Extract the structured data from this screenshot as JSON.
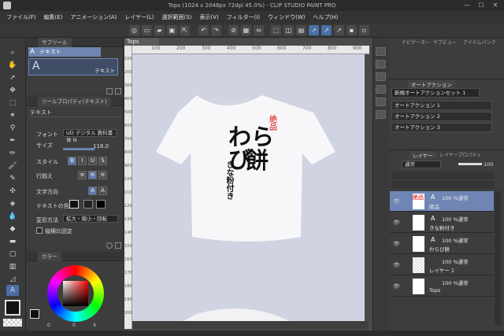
{
  "window": {
    "title": "Tops (1024 x 2048px 72dpi 45.0%) - CLIP STUDIO PAINT PRO",
    "min": "—",
    "max": "☐",
    "close": "✕"
  },
  "menu": [
    "ファイル(F)",
    "編集(E)",
    "アニメーション(A)",
    "レイヤー(L)",
    "選択範囲(S)",
    "表示(V)",
    "フィルター(I)",
    "ウィンドウ(W)",
    "ヘルプ(H)"
  ],
  "subtool": {
    "tab": "サブツール",
    "selected": "テキスト",
    "big_label": "テキスト",
    "big_icon": "A"
  },
  "toolprop": {
    "tab": "ツールプロパティ(テキスト)",
    "heading": "テキスト",
    "font_label": "フォント",
    "font_value": "UD デジタル 教科書体 N",
    "size_label": "サイズ",
    "size_value": "118.0",
    "style_label": "スタイル",
    "bold": "B",
    "italic": "I",
    "underline": "U",
    "strike": "S",
    "align_label": "行揃え",
    "direction_label": "文字方向",
    "color_label": "テキストの色",
    "transform_label": "変形方法",
    "transform_value": "拡大・縮小・回転",
    "keep_ratio_label": "縦横比固定"
  },
  "colorpanel": {
    "tab": "カラー",
    "values": [
      "0",
      "0",
      "4"
    ]
  },
  "canvas": {
    "tab": "Tops",
    "ruler_top": [
      "100",
      "200",
      "300",
      "400",
      "500",
      "600",
      "700",
      "800",
      "900"
    ],
    "ruler_left": [
      "100",
      "200",
      "300",
      "400",
      "500",
      "600",
      "700",
      "800",
      "900",
      "1000",
      "1100",
      "1200",
      "1300",
      "1400",
      "1500",
      "1600",
      "1700",
      "1800",
      "1900",
      "2000"
    ],
    "text_red": "絶品",
    "text_main_1": "わらび",
    "text_main_2": "餅",
    "text_sub": "きな粉付き"
  },
  "nav": {
    "tab1": "ナビゲーター",
    "tab2": "サブビュー",
    "tab3": "アイテムバンク"
  },
  "actions": {
    "tab": "オートアクション",
    "set": "新規オートアクションセット 1",
    "items": [
      "オートアクション 1",
      "オートアクション 2",
      "オートアクション 3"
    ]
  },
  "layers": {
    "tab": "レイヤー",
    "tab2": "レイヤープロパティ",
    "blend": "通常",
    "opacity": "100",
    "items": [
      {
        "mode": "100 %通常",
        "name": "絶品"
      },
      {
        "mode": "100 %通常",
        "name": "きな粉付き"
      },
      {
        "mode": "100 %通常",
        "name": "わらび餅"
      },
      {
        "mode": "100 %通常",
        "name": "レイヤー 1"
      },
      {
        "mode": "100 %通常",
        "name": "Tops"
      }
    ]
  },
  "colors": {
    "accent": "#4b6fa8",
    "selected": "#6e85b2",
    "red_text": "#e00000"
  }
}
